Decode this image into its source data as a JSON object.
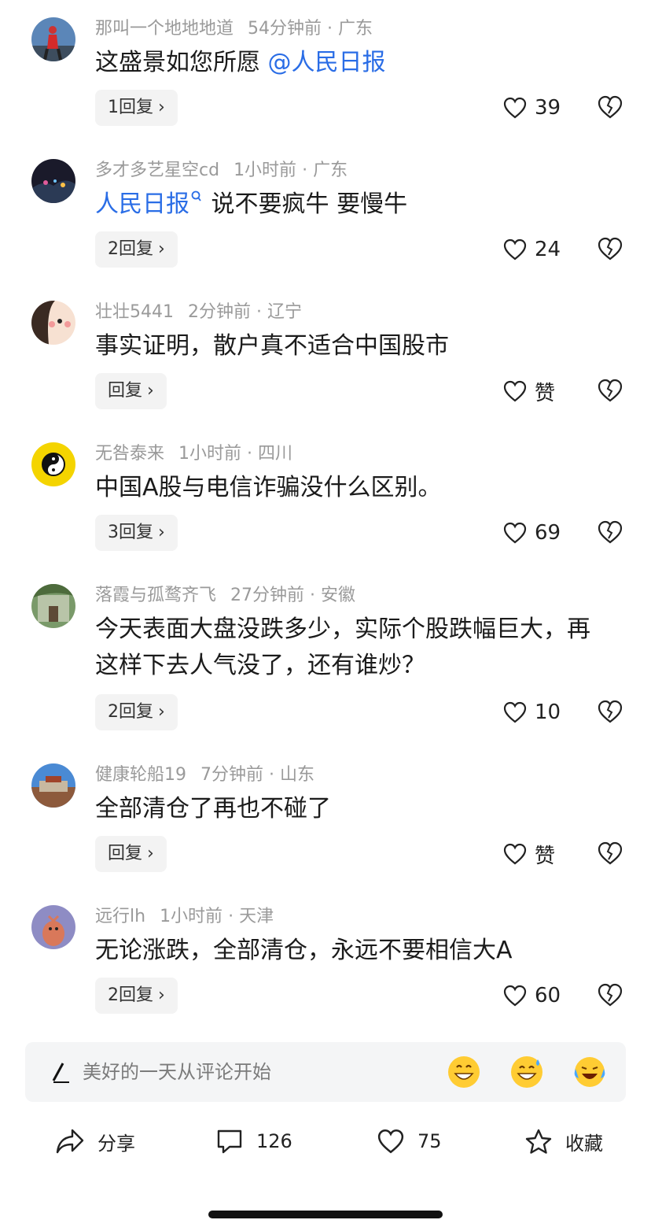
{
  "comments": [
    {
      "user": "那叫一个地地地道",
      "time": "54分钟前",
      "location": "广东",
      "body_mention_suffix": "",
      "body": "这盛景如您所愿 ",
      "mention": "@人民日报",
      "reply_label": "1回复",
      "likes": "39",
      "avatar": "avatar-climber"
    },
    {
      "user": "多才多艺星空cd",
      "time": "1小时前",
      "location": "广东",
      "mention": "人民日报",
      "mention_icon": "search-icon",
      "body": " 说不要疯牛 要慢牛",
      "reply_label": "2回复",
      "likes": "24",
      "avatar": "avatar-night"
    },
    {
      "user": "壮壮5441",
      "time": "2分钟前",
      "location": "辽宁",
      "body": "事实证明，散户真不适合中国股市",
      "reply_label": "回复",
      "likes": "赞",
      "avatar": "avatar-cartoon"
    },
    {
      "user": "无咎泰来",
      "time": "1小时前",
      "location": "四川",
      "body": "中国A股与电信诈骗没什么区别。",
      "reply_label": "3回复",
      "likes": "69",
      "avatar": "avatar-taiji"
    },
    {
      "user": "落霞与孤鹜齐飞",
      "time": "27分钟前",
      "location": "安徽",
      "body": "今天表面大盘没跌多少，实际个股跌幅巨大，再这样下去人气没了，还有谁炒？",
      "reply_label": "2回复",
      "likes": "10",
      "avatar": "avatar-garden"
    },
    {
      "user": "健康轮船19",
      "time": "7分钟前",
      "location": "山东",
      "body": "全部清仓了再也不碰了",
      "reply_label": "回复",
      "likes": "赞",
      "avatar": "avatar-palace"
    },
    {
      "user": "远行lh",
      "time": "1小时前",
      "location": "天津",
      "body": "无论涨跌，全部清仓，永远不要相信大A",
      "reply_label": "2回复",
      "likes": "60",
      "avatar": "avatar-bird"
    }
  ],
  "meta_separator": "·",
  "compose": {
    "placeholder": "美好的一天从评论开始",
    "emojis": [
      "grin-emoji",
      "sweat-smile-emoji",
      "crying-laugh-emoji"
    ]
  },
  "bottom_bar": {
    "share_label": "分享",
    "comment_count": "126",
    "like_count": "75",
    "favorite_label": "收藏"
  },
  "colors": {
    "mention": "#2a6de6",
    "meta": "#9a9a9a",
    "reply_bg": "#f3f3f3",
    "compose_bg": "#f4f5f6"
  }
}
